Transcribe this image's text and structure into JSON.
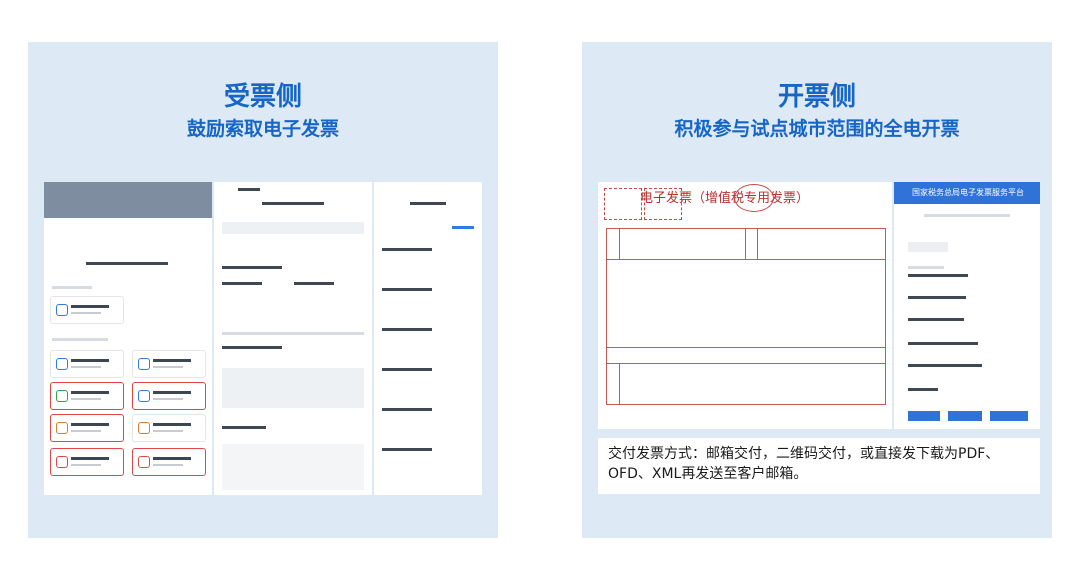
{
  "left": {
    "title": "受票侧",
    "subtitle": "鼓励索取电子发票"
  },
  "right": {
    "title": "开票侧",
    "subtitle": "积极参与试点城市范围的全电开票",
    "invoice_heading": "电子发票（增值税专用发票）",
    "platform_title": "国家税务总局电子发票服务平台",
    "caption": "交付发票方式：邮箱交付，二维码交付，或直接发下载为PDF、OFD、XML再发送至客户邮箱。"
  },
  "colors": {
    "accent": "#1666c8",
    "panel_bg": "#dde9f5",
    "highlight_red": "#e04848",
    "invoice_red": "#b5322d"
  }
}
